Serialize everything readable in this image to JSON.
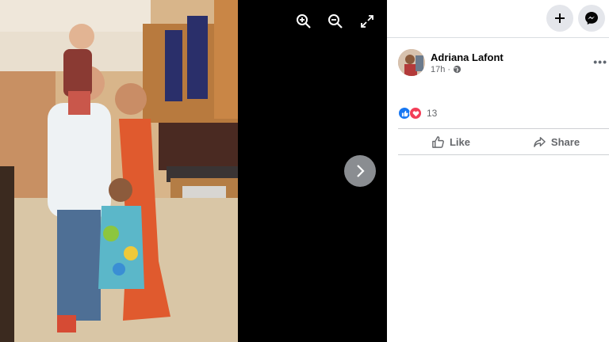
{
  "viewer": {
    "zoom_in_icon": "zoom-in-icon",
    "zoom_out_icon": "zoom-out-icon",
    "fullscreen_icon": "fullscreen-icon",
    "next_icon": "chevron-right-icon"
  },
  "header": {
    "create_icon": "plus-icon",
    "messenger_icon": "messenger-icon"
  },
  "post": {
    "author": "Adriana Lafont",
    "time": "17h",
    "visibility_icon": "globe-icon",
    "more_icon": "ellipsis-icon",
    "reaction_count": "13",
    "like_label": "Like",
    "share_label": "Share"
  },
  "colors": {
    "like_blue": "#1877f2",
    "love_red": "#f33e58",
    "panel_bg": "#ffffff",
    "viewer_bg": "#000000"
  }
}
